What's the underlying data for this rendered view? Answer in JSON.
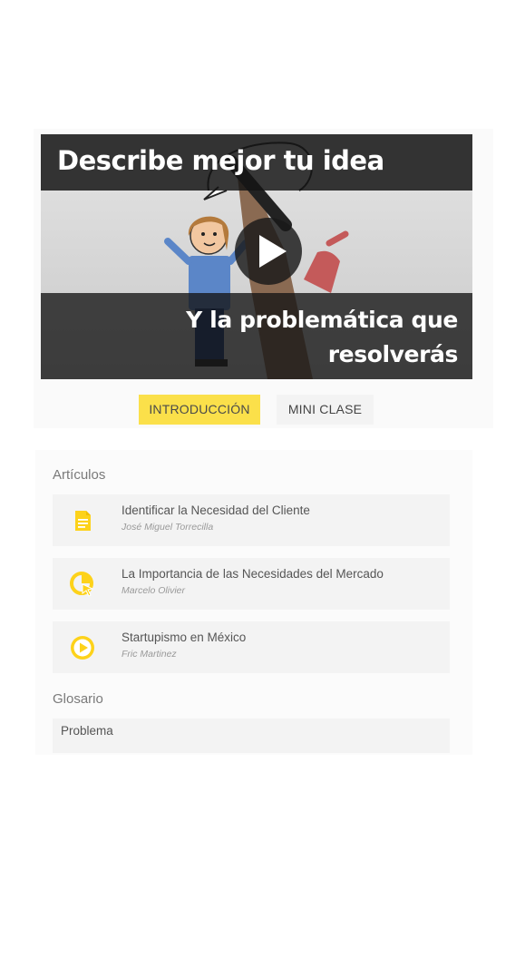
{
  "video": {
    "title_top": "Describe mejor tu idea",
    "title_bottom": "Y la problemática que resolverás"
  },
  "tabs": [
    {
      "label": "INTRODUCCIÓN",
      "active": true
    },
    {
      "label": "MINI CLASE",
      "active": false
    }
  ],
  "articles_section": {
    "title": "Artículos",
    "items": [
      {
        "title": "Identificar la Necesidad del Cliente",
        "author": "José Miguel Torrecilla",
        "icon": "document-icon"
      },
      {
        "title": "La Importancia de las Necesidades del Mercado",
        "author": "Marcelo Olivier",
        "icon": "chart-cursor-icon"
      },
      {
        "title": "Startupismo en México",
        "author": "Fric Martinez",
        "icon": "play-circle-icon"
      }
    ]
  },
  "glossary_section": {
    "title": "Glosario",
    "items": [
      {
        "label": "Problema"
      }
    ]
  },
  "colors": {
    "accent_yellow": "#fbe04a",
    "icon_yellow": "#fdd21a"
  }
}
